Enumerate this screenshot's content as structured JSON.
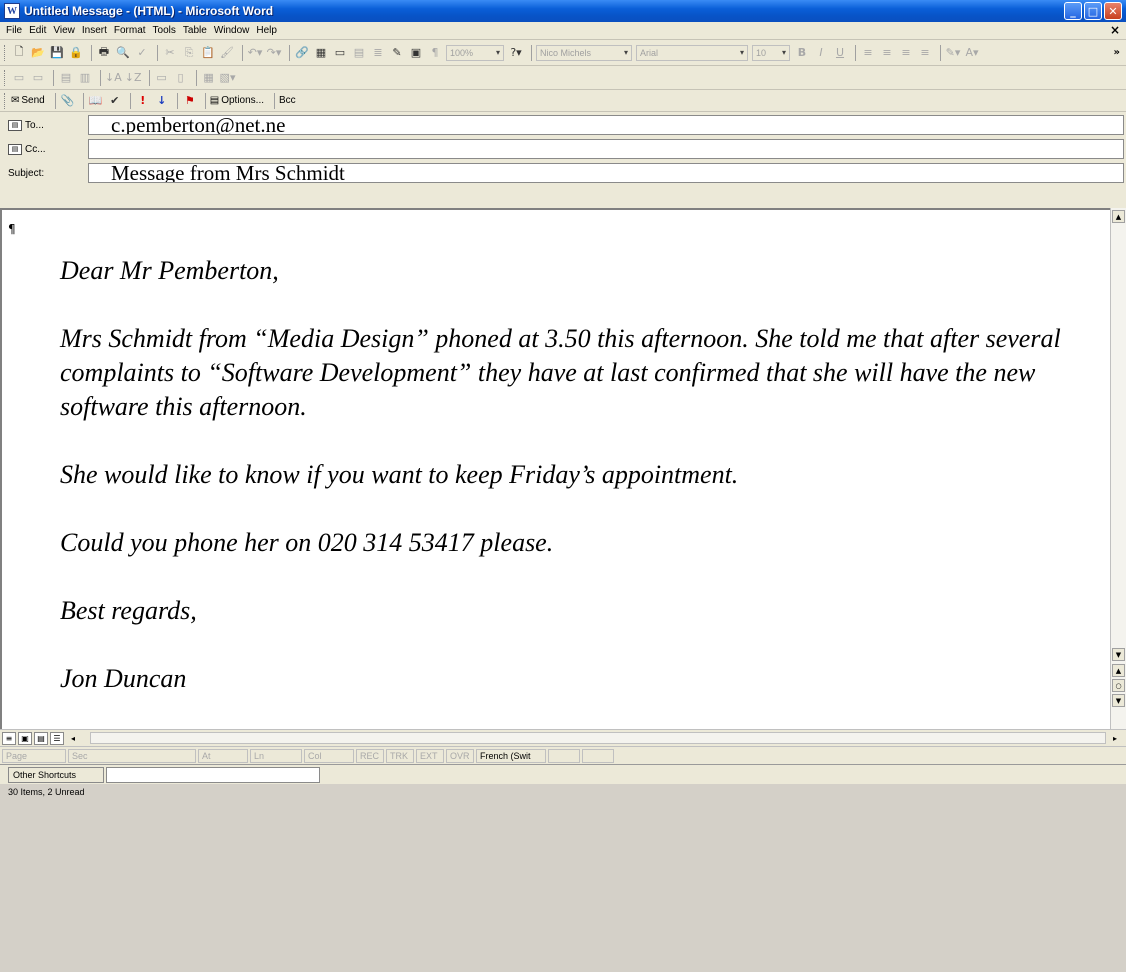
{
  "window": {
    "title": "Untitled Message - (HTML) - Microsoft Word",
    "app_icon": "word-doc-icon"
  },
  "menu": [
    "File",
    "Edit",
    "View",
    "Insert",
    "Format",
    "Tools",
    "Table",
    "Window",
    "Help"
  ],
  "toolbar": {
    "zoom": "100%",
    "style_name": "Nico Michels",
    "font_name": "Arial",
    "font_size": "10",
    "send_label": "Send",
    "options_label": "Options...",
    "bcc_label": "Bcc"
  },
  "header": {
    "to_label": "To...",
    "to_value": "c.pemberton@net.ne",
    "cc_label": "Cc...",
    "cc_value": "",
    "subject_label": "Subject:",
    "subject_value": "Message from Mrs Schmidt"
  },
  "document": {
    "pilcrow": "¶",
    "paragraphs": [
      "Dear Mr Pemberton,",
      "Mrs Schmidt from “Media Design” phoned at 3.50 this afternoon. She told me that after several complaints to “Software Development” they have at last confirmed that she will have the new software this afternoon.",
      "She would like to know if you want to keep Friday’s appointment.",
      "Could you phone her on 020 314 53417 please.",
      "Best regards,",
      "Jon Duncan"
    ]
  },
  "status": {
    "page": "Page",
    "sec": "Sec",
    "at": "At",
    "ln": "Ln",
    "col": "Col",
    "rec": "REC",
    "trk": "TRK",
    "ext": "EXT",
    "ovr": "OVR",
    "language": "French (Swit"
  },
  "outlook": {
    "shortcuts_label": "Other Shortcuts",
    "items_status": "30 Items, 2 Unread"
  }
}
